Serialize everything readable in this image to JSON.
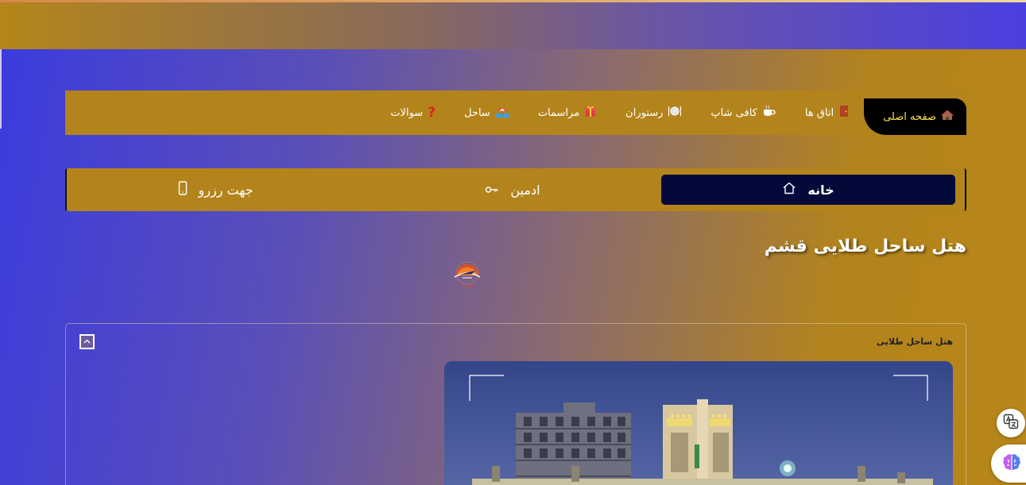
{
  "nav": {
    "home": "صفحه اصلی",
    "rooms": "اتاق ها",
    "cafe": "کافی شاپ",
    "restaurant": "رستوران",
    "events": "مراسمات",
    "beach": "ساحل",
    "faq": "سوالات"
  },
  "bar2": {
    "home": "خانه",
    "admin": "ادمین",
    "reserve": "جهت رزرو"
  },
  "hotel_title": "هتل ساحل طلایی قشم",
  "card": {
    "title": "هتل ساحل طلایی"
  },
  "colors": {
    "nav_bg": "#b3841c",
    "active_tab_bg": "#000000",
    "active_tab_text": "#ffe34d",
    "home_button_bg": "#030a3a"
  }
}
